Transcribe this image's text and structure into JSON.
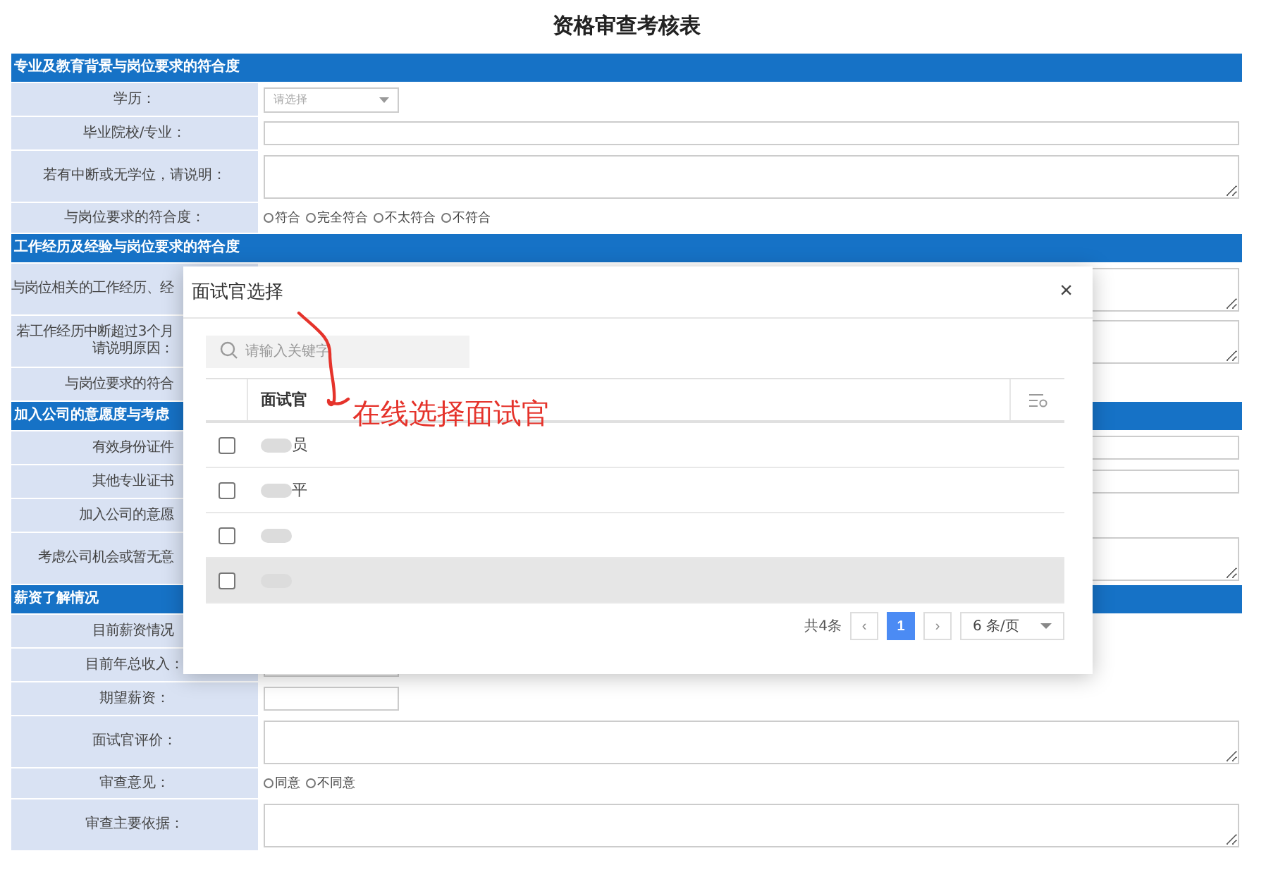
{
  "title": "资格审查考核表",
  "sections": [
    {
      "heading": "专业及教育背景与岗位要求的符合度",
      "rows": [
        {
          "label": "学历：",
          "kind": "select",
          "short": true,
          "placeholder": "请选择"
        },
        {
          "label": "毕业院校/专业：",
          "kind": "input",
          "short": false
        },
        {
          "label": "若有中断或无学位，请说明：",
          "kind": "textarea"
        },
        {
          "label": "与岗位要求的符合度：",
          "kind": "radio",
          "options": [
            {
              "label": "符合",
              "selected": false
            },
            {
              "label": "完全符合",
              "selected": false
            },
            {
              "label": "不太符合",
              "selected": false
            },
            {
              "label": "不符合",
              "selected": false
            }
          ]
        }
      ]
    },
    {
      "heading": "工作经历及经验与岗位要求的符合度",
      "rows": [
        {
          "label": "与岗位相关的工作经历、经",
          "cut": true,
          "kind": "textarea"
        },
        {
          "label": "若工作经历中断超过3个月",
          "label_2": "请说明原因：",
          "cut": true,
          "kind": "textarea"
        },
        {
          "label": "与岗位要求的符合",
          "cut": true
        }
      ]
    },
    {
      "heading": "加入公司的意愿度与考虑",
      "rows": [
        {
          "label": "有效身份证件",
          "cut": true,
          "kind": "input",
          "short": false
        },
        {
          "label": "其他专业证书",
          "cut": true,
          "kind": "input",
          "short": false
        },
        {
          "label": "加入公司的意愿",
          "cut": true
        },
        {
          "label": "考虑公司机会或暂无意",
          "cut": true,
          "kind": "textarea"
        }
      ]
    },
    {
      "heading": "薪资了解情况",
      "rows": [
        {
          "label": "目前薪资情况",
          "cut": true
        },
        {
          "label": "目前年总收入：",
          "kind": "input",
          "short": true
        },
        {
          "label": "期望薪资：",
          "kind": "input",
          "short": true
        },
        {
          "label": "面试官评价：",
          "kind": "textarea"
        },
        {
          "label": "审查意见：",
          "kind": "radio",
          "options": [
            {
              "label": "同意",
              "selected": false
            },
            {
              "label": "不同意",
              "selected": false
            }
          ]
        },
        {
          "label": "审查主要依据：",
          "kind": "textarea"
        }
      ]
    }
  ],
  "dialog": {
    "title": "面试官选择",
    "close": "×",
    "search": {
      "placeholder": "请输入关键字"
    },
    "column": "面试官",
    "rows": [
      {
        "name": "员",
        "redacted": true,
        "checked": false,
        "highlighted": false
      },
      {
        "name": "平",
        "redacted": true,
        "checked": false,
        "highlighted": false
      },
      {
        "redacted": true,
        "checked": false,
        "highlighted": false
      },
      {
        "redacted": true,
        "checked": false,
        "highlighted": true
      }
    ],
    "pager": {
      "total": "共4条",
      "prev": "‹",
      "pages": [
        {
          "label": "1",
          "selected": true
        }
      ],
      "next": "›",
      "page_size": "6 条/页"
    }
  },
  "annotation": {
    "text": "在线选择面试官"
  }
}
